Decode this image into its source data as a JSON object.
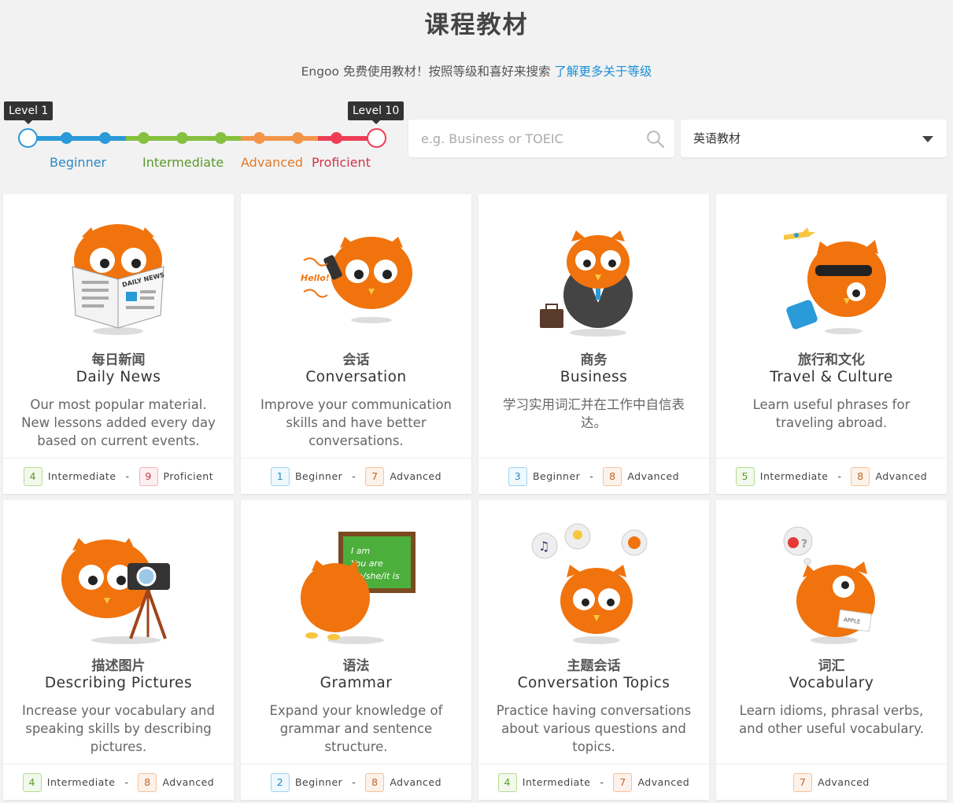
{
  "header": {
    "title": "课程教材",
    "subtitle_prefix": "Engoo 免费使用教材！按照等级和喜好来搜索",
    "subtitle_link": "了解更多关于等级"
  },
  "slider": {
    "min_tooltip": "Level 1",
    "max_tooltip": "Level 10",
    "selected_min": 1,
    "selected_max": 10,
    "labels": [
      "Beginner",
      "Intermediate",
      "Advanced",
      "Proficient"
    ],
    "colors": {
      "beginner": "#2a9ad8",
      "intermediate": "#86c03f",
      "advanced": "#f39549",
      "proficient": "#ee3d55"
    }
  },
  "search": {
    "placeholder": "e.g. Business or TOEIC"
  },
  "category_select": {
    "value": "英语教材"
  },
  "accent_orange": "#f0730d",
  "cards": [
    {
      "cn": "每日新闻",
      "en": "Daily News",
      "desc": "Our most popular material. New lessons added every day based on current events.",
      "min_level": "4",
      "min_label": "Intermediate",
      "max_level": "9",
      "max_label": "Proficient",
      "icon": "owl-reading-newspaper-icon"
    },
    {
      "cn": "会话",
      "en": "Conversation",
      "desc": "Improve your communication skills and have better conversations.",
      "min_level": "1",
      "min_label": "Beginner",
      "max_level": "7",
      "max_label": "Advanced",
      "icon": "owl-phone-call-icon"
    },
    {
      "cn": "商务",
      "en": "Business",
      "desc": "学习实用词汇并在工作中自信表达。",
      "min_level": "3",
      "min_label": "Beginner",
      "max_level": "8",
      "max_label": "Advanced",
      "icon": "owl-businessman-icon"
    },
    {
      "cn": "旅行和文化",
      "en": "Travel & Culture",
      "desc": "Learn useful phrases for traveling abroad.",
      "min_level": "5",
      "min_label": "Intermediate",
      "max_level": "8",
      "max_label": "Advanced",
      "icon": "owl-traveler-icon"
    },
    {
      "cn": "描述图片",
      "en": "Describing Pictures",
      "desc": "Increase your vocabulary and speaking skills by describing pictures.",
      "min_level": "4",
      "min_label": "Intermediate",
      "max_level": "8",
      "max_label": "Advanced",
      "icon": "owl-camera-icon"
    },
    {
      "cn": "语法",
      "en": "Grammar",
      "desc": "Expand your knowledge of grammar and sentence structure.",
      "min_level": "2",
      "min_label": "Beginner",
      "max_level": "8",
      "max_label": "Advanced",
      "icon": "owl-chalkboard-icon",
      "board_lines": [
        "I am",
        "You are",
        "He/she/it is"
      ]
    },
    {
      "cn": "主题会话",
      "en": "Conversation Topics",
      "desc": "Practice having conversations about various questions and topics.",
      "min_level": "4",
      "min_label": "Intermediate",
      "max_level": "7",
      "max_label": "Advanced",
      "icon": "owl-thought-bubbles-icon"
    },
    {
      "cn": "词汇",
      "en": "Vocabulary",
      "desc": "Learn idioms, phrasal verbs, and other useful vocabulary.",
      "min_level": "",
      "min_label": "",
      "max_level": "7",
      "max_label": "Advanced",
      "icon": "owl-apple-card-icon",
      "card_word": "APPLE"
    }
  ]
}
